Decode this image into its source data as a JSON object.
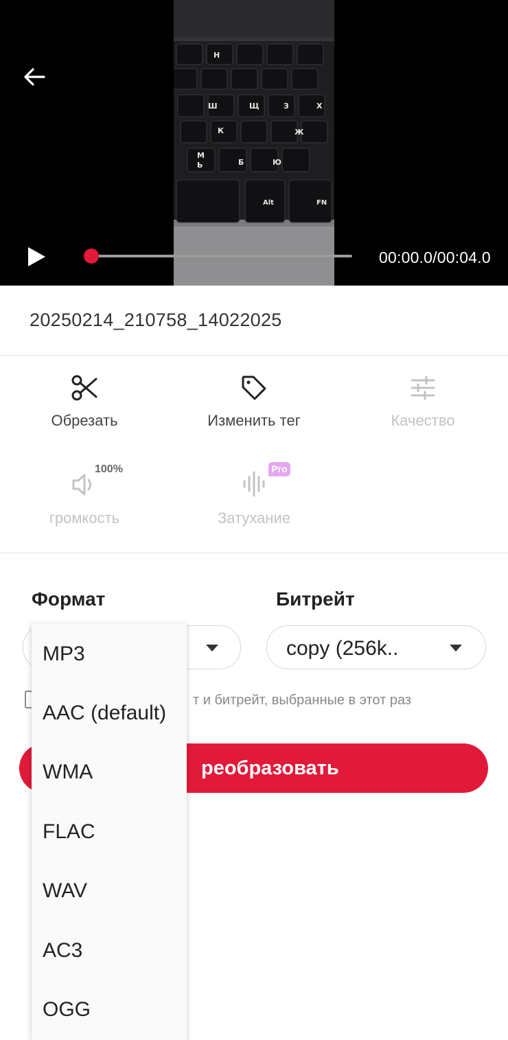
{
  "player": {
    "time_display": "00:00.0/00:04.0",
    "progress": 0.0,
    "accent_color": "#e11a3a",
    "keyboard_keys": [
      "Н",
      "Ш",
      "Щ",
      "З",
      "Х",
      "К",
      "Ж",
      "Б",
      "Ю",
      "М",
      "Ь",
      "Alt",
      "FN"
    ]
  },
  "file": {
    "name": "20250214_210758_14022025"
  },
  "tools": [
    {
      "label": "Обрезать",
      "icon": "scissors-icon",
      "enabled": true
    },
    {
      "label": "Изменить тег",
      "icon": "tag-icon",
      "enabled": true
    },
    {
      "label": "Качество",
      "icon": "sliders-icon",
      "enabled": false
    },
    {
      "label": "громкость",
      "icon": "volume-icon",
      "enabled": false,
      "badge": "100%"
    },
    {
      "label": "Затухание",
      "icon": "waveform-icon",
      "enabled": false,
      "badge": "Pro"
    }
  ],
  "format": {
    "label": "Формат"
  },
  "bitrate": {
    "label": "Битрейт",
    "value": "copy (256k.."
  },
  "remember": {
    "text": "т и битрейт, выбранные в этот раз",
    "checked": false
  },
  "convert_button": {
    "label": "реобразовать"
  },
  "format_dropdown": {
    "options": [
      "MP3",
      "AAC (default)",
      "WMA",
      "FLAC",
      "WAV",
      "AC3",
      "OGG"
    ]
  }
}
